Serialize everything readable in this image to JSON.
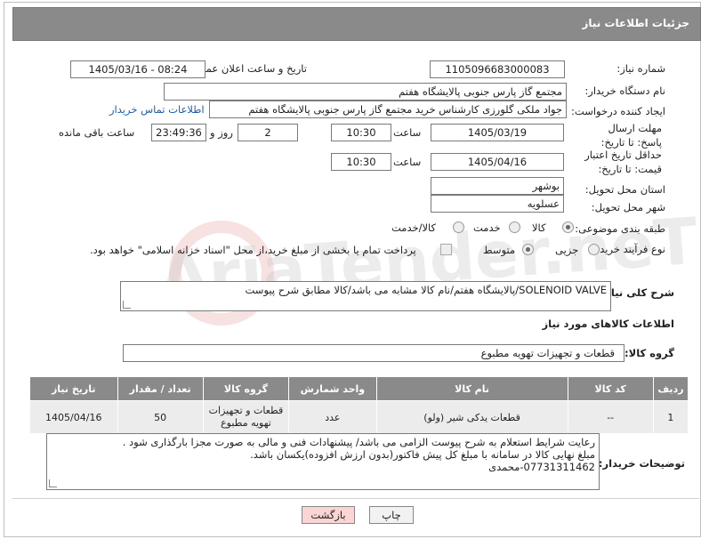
{
  "header": {
    "title": "جزئیات اطلاعات نیاز"
  },
  "fields": {
    "need_number_label": "شماره نیاز:",
    "need_number": "1105096683000083",
    "announce_label": "تاریخ و ساعت اعلان عمومی:",
    "announce_value": "1405/03/16 - 08:24",
    "buyer_org_label": "نام دستگاه خریدار:",
    "buyer_org": "مجتمع گاز پارس جنوبی  پالایشگاه هفتم",
    "creator_label": "ایجاد کننده درخواست:",
    "creator": "جواد ملکی گلورزی کارشناس خرید مجتمع گاز پارس جنوبی  پالایشگاه هفتم",
    "contact_link": "اطلاعات تماس خریدار",
    "reply_deadline_label": "مهلت ارسال پاسخ: تا تاریخ:",
    "reply_date": "1405/03/19",
    "time_label": "ساعت",
    "reply_time": "10:30",
    "days_value": "2",
    "days_label": "روز و",
    "remaining_time": "23:49:36",
    "remaining_label": "ساعت باقی مانده",
    "price_validity_label": "حداقل تاریخ اعتبار قیمت: تا تاریخ:",
    "price_date": "1405/04/16",
    "price_time": "10:30",
    "province_label": "استان محل تحویل:",
    "province": "بوشهر",
    "city_label": "شهر محل تحویل:",
    "city": "عسلویه",
    "category_label": "طبقه بندی موضوعی:",
    "category_options": [
      "کالا",
      "خدمت",
      "کالا/خدمت"
    ],
    "process_label": "نوع فرآیند خرید :",
    "process_options": [
      "جزیی",
      "متوسط"
    ],
    "payment_note": "پرداخت تمام یا بخشی از مبلغ خرید،از محل \"اسناد خزانه اسلامی\" خواهد بود.",
    "description_label": "شرح کلی نیاز:",
    "description": "SOLENOID VALVE/پالایشگاه هفتم/نام کالا مشابه می باشد/کالا مطابق شرح پیوست",
    "goods_info_title": "اطلاعات کالاهای مورد نیاز",
    "goods_group_label": "گروه کالا:",
    "goods_group": "قطعات و تجهیزات تهویه مطبوع"
  },
  "table": {
    "headers": [
      "ردیف",
      "کد کالا",
      "نام کالا",
      "واحد شمارش",
      "گروه کالا",
      "تعداد / مقدار",
      "تاریخ نیاز"
    ],
    "rows": [
      {
        "row": "1",
        "code": "--",
        "name": "قطعات یدکی شیر (ولو)",
        "unit": "عدد",
        "group": "قطعات و تجهیزات تهویه مطبوع",
        "qty": "50",
        "date": "1405/04/16"
      }
    ]
  },
  "buyer_notes": {
    "label": "توضیحات خریدار:",
    "line1": "رعایت شرایط استعلام به شرح پیوست الزامی می باشد/ پیشنهادات فنی و مالی به صورت مجزا بارگذاری شود .",
    "line2": "مبلغ نهایی کالا در سامانه با مبلغ کل پیش فاکتور(بدون ارزش افزوده)یکسان باشد.",
    "line3": "07731311462-محمدی"
  },
  "buttons": {
    "print": "چاپ",
    "back": "بازگشت"
  },
  "watermark": "AriaTender.neT"
}
